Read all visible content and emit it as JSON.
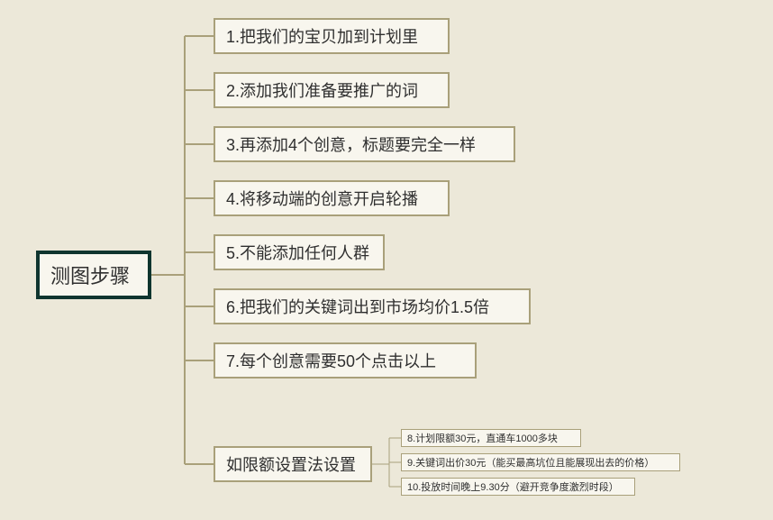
{
  "root": {
    "label": "测图步骤"
  },
  "children": [
    {
      "label": "1.把我们的宝贝加到计划里"
    },
    {
      "label": "2.添加我们准备要推广的词"
    },
    {
      "label": "3.再添加4个创意，标题要完全一样"
    },
    {
      "label": "4.将移动端的创意开启轮播"
    },
    {
      "label": "5.不能添加任何人群"
    },
    {
      "label": "6.把我们的关键词出到市场均价1.5倍"
    },
    {
      "label": "7.每个创意需要50个点击以上"
    },
    {
      "label": "如限额设置法设置"
    }
  ],
  "subchildren": [
    {
      "label": "8.计划限额30元，直通车1000多块"
    },
    {
      "label": "9.关键词出价30元（能买最高坑位且能展现出去的价格）"
    },
    {
      "label": "10.投放时间晚上9.30分（避开竞争度激烈时段）"
    }
  ]
}
